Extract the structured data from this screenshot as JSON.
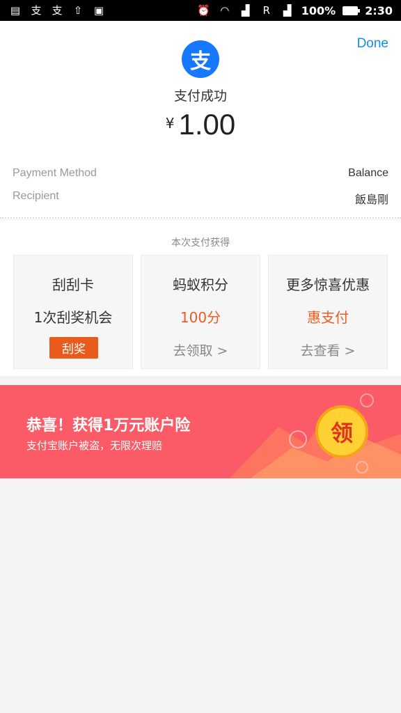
{
  "status_bar": {
    "battery_percent": "100%",
    "time": "2:30",
    "left_icons": [
      "notification-icon",
      "alipay-icon",
      "alipay-icon",
      "upload-icon",
      "image-icon"
    ],
    "right_icons": [
      "alarm-icon",
      "wifi-icon",
      "signal-icon",
      "r-icon",
      "signal-icon",
      "battery-icon"
    ]
  },
  "header": {
    "done_label": "Done",
    "logo_glyph": "支",
    "title": "支付成功",
    "currency": "¥",
    "amount": "1.00"
  },
  "details": [
    {
      "label": "Payment Method",
      "value": "Balance"
    },
    {
      "label": "Recipient",
      "value": "飯島剛"
    }
  ],
  "rewards": {
    "title": "本次支付获得",
    "cards": [
      {
        "title": "刮刮卡",
        "subtitle": "1次刮奖机会",
        "action": "刮奖"
      },
      {
        "title": "蚂蚁积分",
        "subtitle": "100分",
        "action": "去领取 >"
      },
      {
        "title": "更多惊喜优惠",
        "subtitle": "惠支付",
        "action": "去查看 >"
      }
    ]
  },
  "banner": {
    "title": "恭喜！获得1万元账户险",
    "subtitle": "支付宝账户被盗，无限次理赔",
    "coin_label": "领"
  },
  "colors": {
    "accent_blue": "#108ee9",
    "orange": "#f05a23",
    "banner_red": "#fb5b66"
  }
}
